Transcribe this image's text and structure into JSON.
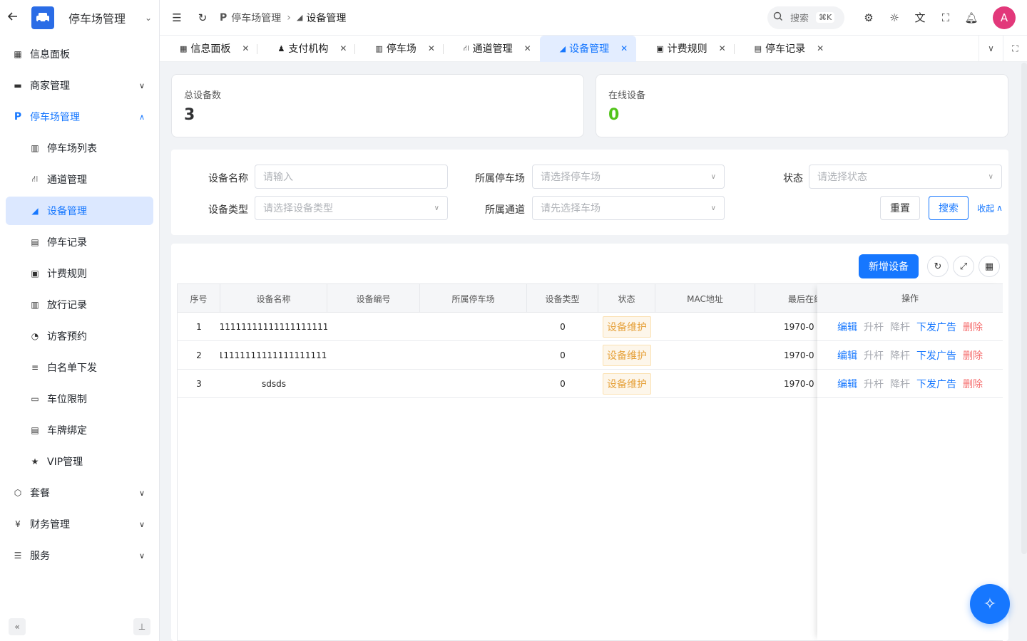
{
  "sidebar": {
    "title": "停车场管理",
    "items": [
      {
        "label": "信息面板",
        "icon": "dashboard-icon"
      },
      {
        "label": "商家管理",
        "icon": "store-icon"
      },
      {
        "label": "停车场管理",
        "icon": "parking-icon"
      },
      {
        "label": "停车场列表",
        "icon": "building-icon"
      },
      {
        "label": "通道管理",
        "icon": "road-icon"
      },
      {
        "label": "设备管理",
        "icon": "camera-icon"
      },
      {
        "label": "停车记录",
        "icon": "clipboard-icon"
      },
      {
        "label": "计费规则",
        "icon": "money-icon"
      },
      {
        "label": "放行记录",
        "icon": "barrier-icon"
      },
      {
        "label": "访客预约",
        "icon": "visitor-icon"
      },
      {
        "label": "白名单下发",
        "icon": "list-check-icon"
      },
      {
        "label": "车位限制",
        "icon": "truck-icon"
      },
      {
        "label": "车牌绑定",
        "icon": "card-icon"
      },
      {
        "label": "VIP管理",
        "icon": "star-icon"
      },
      {
        "label": "套餐",
        "icon": "package-icon"
      },
      {
        "label": "财务管理",
        "icon": "yen-icon"
      },
      {
        "label": "服务",
        "icon": "server-icon"
      }
    ]
  },
  "topbar": {
    "breadcrumb": [
      "停车场管理",
      "设备管理"
    ],
    "search_label": "搜索",
    "search_shortcut": "⌘K",
    "avatar": "A"
  },
  "tabs": [
    {
      "label": "信息面板"
    },
    {
      "label": "支付机构"
    },
    {
      "label": "停车场"
    },
    {
      "label": "通道管理"
    },
    {
      "label": "设备管理"
    },
    {
      "label": "计费规则"
    },
    {
      "label": "停车记录"
    }
  ],
  "stats": {
    "total_label": "总设备数",
    "total_value": "3",
    "online_label": "在线设备",
    "online_value": "0",
    "online_color": "#52c41a"
  },
  "filter": {
    "name_label": "设备名称",
    "name_placeholder": "请输入",
    "lot_label": "所属停车场",
    "lot_placeholder": "请选择停车场",
    "status_label": "状态",
    "status_placeholder": "请选择状态",
    "type_label": "设备类型",
    "type_placeholder": "请选择设备类型",
    "channel_label": "所属通道",
    "channel_placeholder": "请先选择车场",
    "reset_label": "重置",
    "search_label": "搜索",
    "collapse_label": "收起"
  },
  "table": {
    "add_label": "新增设备",
    "headers": [
      "序号",
      "设备名称",
      "设备编号",
      "所属停车场",
      "设备类型",
      "状态",
      "MAC地址",
      "最后在线",
      "操作"
    ],
    "rows": [
      {
        "index": "1",
        "name": "11111111111111111111",
        "type": "0",
        "status": "设备维护",
        "last": "1970-0"
      },
      {
        "index": "2",
        "name": "111111111111111111111...",
        "type": "0",
        "status": "设备维护",
        "last": "1970-0"
      },
      {
        "index": "3",
        "name": "sdsds",
        "type": "0",
        "status": "设备维护",
        "last": "1970-0"
      }
    ],
    "ops": {
      "edit": "编辑",
      "up": "升杆",
      "down": "降杆",
      "ad": "下发广告",
      "del": "删除"
    }
  },
  "colors": {
    "accent": "#1677ff",
    "danger": "#f56c6c",
    "warning": "#e6a23c"
  }
}
